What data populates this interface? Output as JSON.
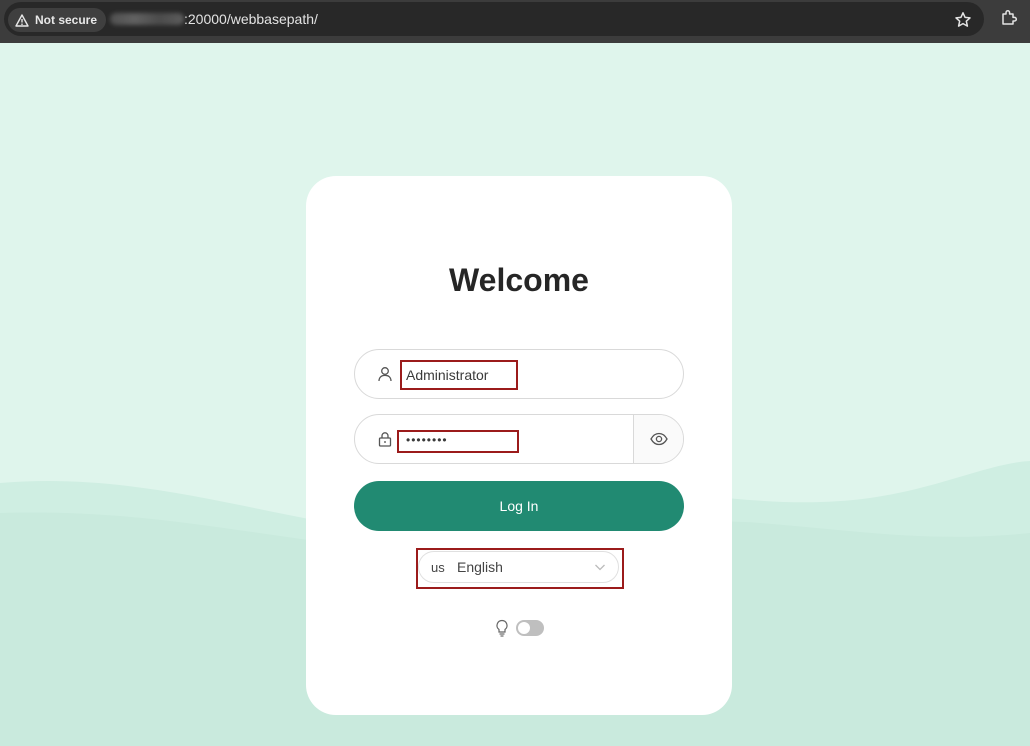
{
  "browser": {
    "security_label": "Not secure",
    "url_path": ":20000/webbasepath/"
  },
  "login": {
    "title": "Welcome",
    "username_value": "Administrator",
    "password_value": "••••••••",
    "login_label": "Log In",
    "language_flag": "us",
    "language_value": "English",
    "theme_toggle_on": false
  },
  "colors": {
    "primary": "#218a72",
    "page_bg": "#dff5ec",
    "highlight_box": "#9b1b1b"
  }
}
